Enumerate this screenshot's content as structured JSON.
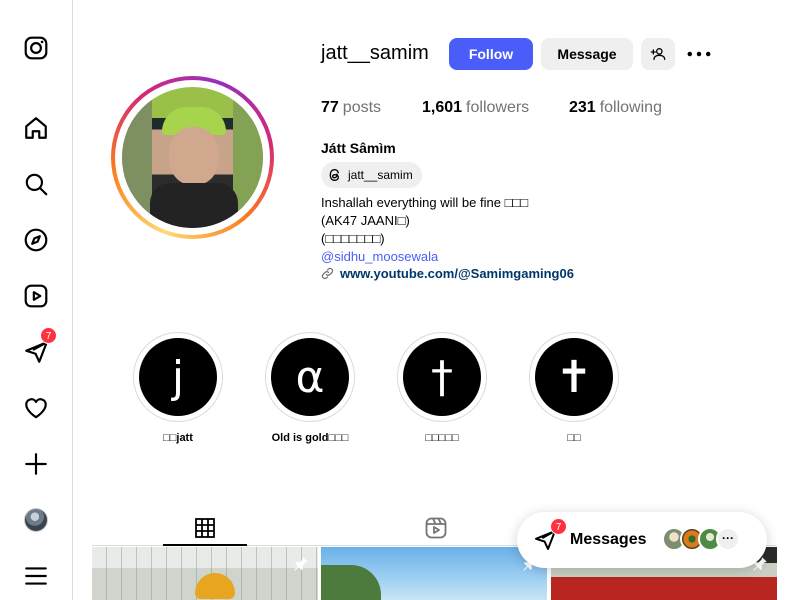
{
  "sidebar": {
    "items": [
      {
        "name": "instagram-logo",
        "label": "Instagram"
      },
      {
        "name": "home",
        "label": "Home"
      },
      {
        "name": "search",
        "label": "Search"
      },
      {
        "name": "explore",
        "label": "Explore"
      },
      {
        "name": "reels",
        "label": "Reels"
      },
      {
        "name": "messages",
        "label": "Messages",
        "badge": "7"
      },
      {
        "name": "notifications",
        "label": "Notifications"
      },
      {
        "name": "create",
        "label": "Create"
      },
      {
        "name": "profile",
        "label": "Profile"
      },
      {
        "name": "more",
        "label": "More"
      }
    ]
  },
  "header": {
    "username": "jatt__samim",
    "follow_label": "Follow",
    "message_label": "Message"
  },
  "stats": {
    "posts_count": "77",
    "posts_label": "posts",
    "followers_count": "1,601",
    "followers_label": "followers",
    "following_count": "231",
    "following_label": "following"
  },
  "bio": {
    "full_name": "Játt Sâmìm",
    "threads_handle": "jatt__samim",
    "line1": "Inshallah everything will be fine ",
    "line1_suffix": "□□□",
    "line2": "(AK47 JAANI",
    "line2_suffix": "□)",
    "line3": "(□□□□□□□)",
    "mention": "@sidhu_moosewala",
    "link": "www.youtube.com/@Samimgaming06"
  },
  "highlights": [
    {
      "glyph": "j",
      "label": "□□jatt"
    },
    {
      "glyph": "α",
      "label": "Old is gold□□□"
    },
    {
      "glyph": "†",
      "label": "□□□□□"
    },
    {
      "glyph": "✝",
      "label": "□□"
    }
  ],
  "tabs": [
    {
      "name": "posts",
      "active": true
    },
    {
      "name": "reels",
      "active": false
    }
  ],
  "messages_pill": {
    "label": "Messages",
    "badge": "7",
    "overflow": "···"
  },
  "colors": {
    "follow_button": "#4a5df9",
    "secondary_button": "#efefef",
    "notification_badge": "#ff3040",
    "link": "#00376b",
    "mention": "#4a5df9"
  }
}
